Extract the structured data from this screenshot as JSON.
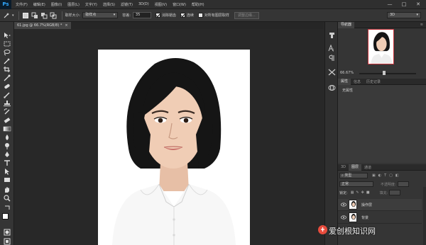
{
  "app": {
    "logo": "Ps"
  },
  "menu": [
    "文件(F)",
    "编辑(E)",
    "图像(I)",
    "图层(L)",
    "文字(Y)",
    "选择(S)",
    "滤镜(T)",
    "3D(D)",
    "视图(V)",
    "窗口(W)",
    "帮助(H)"
  ],
  "window_controls": [
    "—",
    "□",
    "✕"
  ],
  "options_bar": {
    "sample_size_label": "取样大小:",
    "sample_size_value": "取样点",
    "tolerance_label": "容差:",
    "tolerance_value": "35",
    "antialias_label": "消除锯齿",
    "contiguous_label": "连续",
    "all_layers_label": "对所有图层取样",
    "refine_edge_button": "调整边缘...",
    "workspace_value": "3D"
  },
  "document_tab": {
    "title": "61.jpg @ 66.7%(RGB/8) *",
    "close": "×"
  },
  "panels": {
    "navigator_tab": "导航器",
    "zoom_value": "66.67%",
    "properties_tabs": [
      "属性",
      "信息",
      "历史记录"
    ],
    "properties_empty": "无属性",
    "layers_tabs": [
      "3D",
      "图层",
      "通道"
    ],
    "kind_filter": "类型",
    "blend_mode": "正常",
    "opacity_label": "不透明度:",
    "lock_label": "锁定:",
    "fill_label": "填充:",
    "layers": [
      {
        "name": "操作层"
      },
      {
        "name": "背景"
      }
    ]
  },
  "watermark": "爱创根知识网",
  "icons": [
    "magic-wand-icon",
    "move-icon",
    "marquee-icon",
    "lasso-icon",
    "crop-icon",
    "eyedropper-icon",
    "healing-brush-icon",
    "brush-icon",
    "stamp-icon",
    "history-brush-icon",
    "eraser-icon",
    "gradient-icon",
    "blur-icon",
    "dodge-icon",
    "pen-icon",
    "type-icon",
    "path-select-icon",
    "shape-icon",
    "hand-icon",
    "zoom-icon",
    "eye-icon",
    "gear-icon"
  ],
  "colors": {
    "panel_bg": "#353535",
    "canvas_bg": "#282828",
    "accent_red": "#c8343c",
    "ps_blue": "#31a8ff"
  }
}
